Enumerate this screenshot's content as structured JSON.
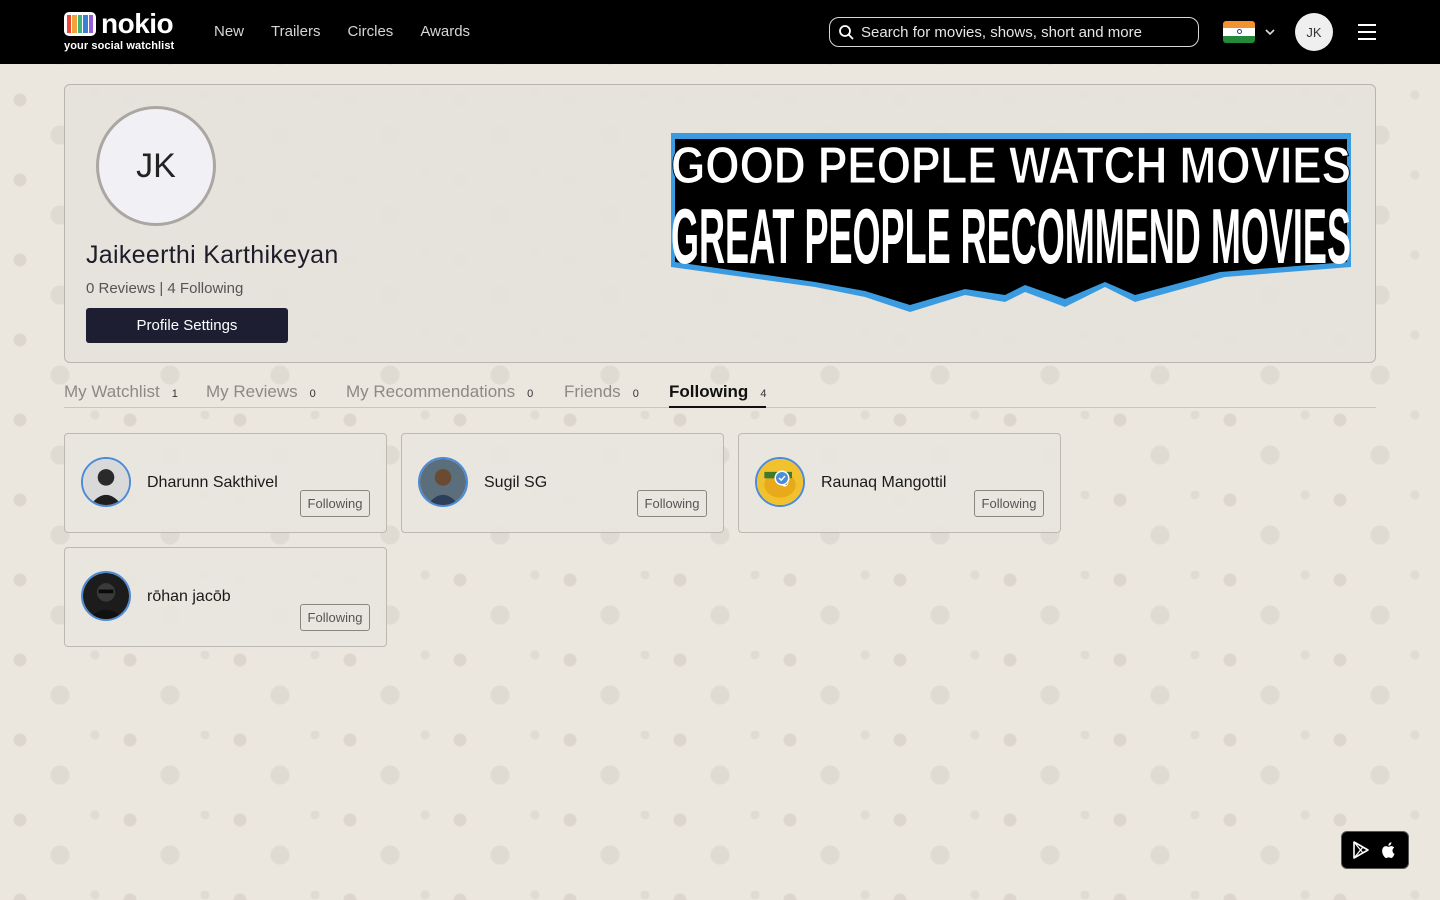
{
  "header": {
    "logo_word": "nokio",
    "logo_tagline": "your social watchlist",
    "nav": [
      "New",
      "Trailers",
      "Circles",
      "Awards"
    ],
    "search_placeholder": "Search for movies, shows, short and more",
    "user_initials": "JK",
    "flag": "india-flag-icon"
  },
  "profile": {
    "initials": "JK",
    "name": "Jaikeerthi Karthikeyan",
    "stats": "0 Reviews | 4 Following",
    "settings_label": "Profile Settings",
    "banner_line1": "GOOD PEOPLE WATCH MOVIES",
    "banner_line2": "GREAT PEOPLE RECOMMEND MOVIES"
  },
  "tabs": [
    {
      "label": "My Watchlist",
      "count": "1"
    },
    {
      "label": "My Reviews",
      "count": "0"
    },
    {
      "label": "My Recommendations",
      "count": "0"
    },
    {
      "label": "Friends",
      "count": "0"
    },
    {
      "label": "Following",
      "count": "4",
      "active": true
    }
  ],
  "following": [
    {
      "name": "Dharunn Sakthivel",
      "button": "Following",
      "verified": false
    },
    {
      "name": "Sugil SG",
      "button": "Following",
      "verified": false
    },
    {
      "name": "Raunaq Mangottil",
      "button": "Following",
      "verified": true
    },
    {
      "name": "rōhan jacōb",
      "button": "Following",
      "verified": false
    }
  ],
  "colors": {
    "header_bg": "#000000",
    "primary_button": "#1e1e33",
    "avatar_ring": "#4c8bd6",
    "banner_blue": "#3b9be0"
  }
}
